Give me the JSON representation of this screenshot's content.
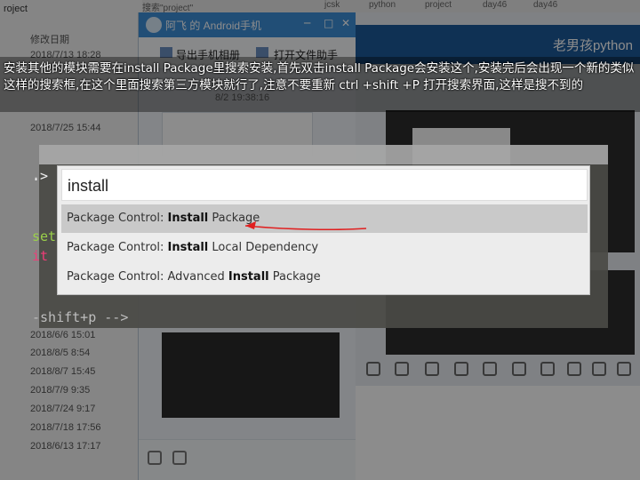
{
  "background": {
    "explorer": {
      "crumb": "roject",
      "column_header": "修改日期",
      "dates": [
        "2018/7/13 18:28",
        "2018/7/25 15:44",
        "2018/6/6 15:01",
        "2018/8/5 8:54",
        "2018/8/7 15:45",
        "2018/7/9 9:35",
        "2018/7/24 9:17",
        "2018/7/18 17:56",
        "2018/6/13 17:17"
      ]
    },
    "topbar": [
      "搜索\"project\"",
      "jcsk",
      "python",
      "project",
      "day46",
      "day46"
    ],
    "qq_window": {
      "title": "阿飞 的 Android手机",
      "tools": [
        "导出手机相册",
        "打开文件助手"
      ],
      "chat_timestamp": "8/2 19:38:16"
    },
    "right_window": {
      "title": "老男孩python"
    },
    "code_lines": [
      {
        "text": ".>",
        "color": "#e0e0e0"
      },
      {
        "text": "set",
        "color": "#9ad04a"
      },
      {
        "text": "it",
        "color": "#f03c78"
      },
      {
        "text": "-shift+p -->",
        "color": "#bdbdbd"
      }
    ]
  },
  "annotation": {
    "text": "安装其他的模块需要在install Package里搜索安装,首先双击install Package会安装这个,安装完后会出现一个新的类似这样的搜索框,在这个里面搜索第三方模块就行了,注意不要重新 ctrl +shift +P 打开搜索界面,这样是搜不到的"
  },
  "command_palette": {
    "query": "install",
    "items": [
      {
        "prefix": "Package Control: ",
        "bold": "Install",
        "suffix": " Package",
        "selected": true
      },
      {
        "prefix": "Package Control: ",
        "bold": "Install",
        "suffix": " Local Dependency",
        "selected": false
      },
      {
        "prefix": "Package Control: Advanced ",
        "bold": "Install",
        "suffix": " Package",
        "selected": false
      }
    ]
  },
  "colors": {
    "arrow": "#e02020",
    "selection": "#c9c9c9"
  }
}
